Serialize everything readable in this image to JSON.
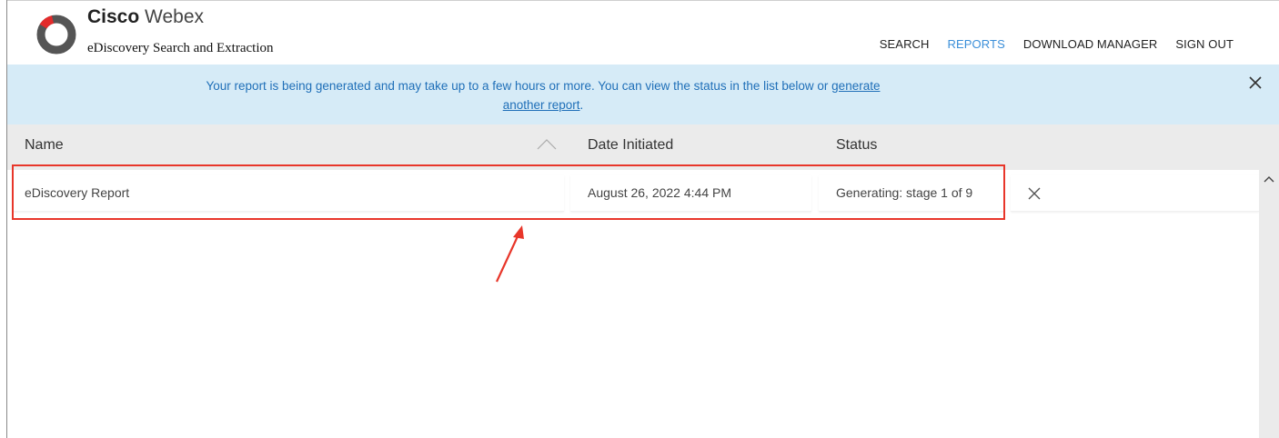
{
  "header": {
    "brand_bold": "Cisco",
    "brand_light": "Webex",
    "subtitle": "eDiscovery Search and Extraction",
    "logo_icon": "webex-logo-icon"
  },
  "nav": {
    "items": [
      {
        "label": "SEARCH",
        "active": false
      },
      {
        "label": "REPORTS",
        "active": true
      },
      {
        "label": "DOWNLOAD MANAGER",
        "active": false
      },
      {
        "label": "SIGN OUT",
        "active": false
      }
    ]
  },
  "banner": {
    "text_before": "Your report is being generated and may take up to a few hours or more. You can view the status in the list below or ",
    "link_part1": "generate",
    "link_part2": "another report",
    "text_after": ".",
    "close_icon": "close-icon"
  },
  "table": {
    "columns": [
      "Name",
      "Date Initiated",
      "Status"
    ],
    "sort_icon": "sort-ascending-icon",
    "rows": [
      {
        "name": "eDiscovery Report",
        "date": "August 26, 2022 4:44 PM",
        "status": "Generating: stage 1 of 9",
        "action_icon": "close-icon"
      }
    ]
  },
  "colors": {
    "accent": "#3b8fd9",
    "banner_bg": "#d6ebf7",
    "banner_text": "#1f6fb8",
    "highlight": "#e8362a",
    "header_bg": "#ebebeb"
  }
}
